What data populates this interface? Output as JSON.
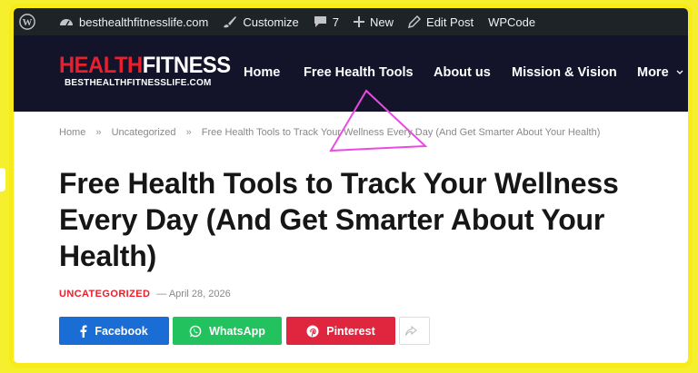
{
  "adminbar": {
    "site": "besthealthfitnesslife.com",
    "customize": "Customize",
    "comments_count": "7",
    "new_label": "New",
    "edit_post": "Edit Post",
    "wpcode": "WPCode"
  },
  "header": {
    "logo_red": "HEALTH",
    "logo_white": "FITNESS",
    "logo_sub": "BESTHEALTHFITNESSLIFE.COM",
    "nav": [
      "Home",
      "Free Health Tools",
      "About us",
      "Mission & Vision",
      "More"
    ]
  },
  "breadcrumb": {
    "home": "Home",
    "sep1": "»",
    "category": "Uncategorized",
    "sep2": "»",
    "current": "Free Health Tools to Track Your Wellness Every Day (And Get Smarter About Your Health)"
  },
  "post": {
    "title": "Free Health Tools to Track Your Wellness Every Day (And Get Smarter About Your Health)",
    "category": "UNCATEGORIZED",
    "date": "— April 28, 2026"
  },
  "share": {
    "facebook": "Facebook",
    "whatsapp": "WhatsApp",
    "pinterest": "Pinterest"
  },
  "colors": {
    "frame": "#f7ec1a",
    "adminbar": "#1d2327",
    "header": "#131329",
    "accent_red": "#e8202c",
    "facebook": "#1a6dd4",
    "whatsapp": "#22c35e",
    "pinterest": "#e0263f",
    "annotation": "#e94be0"
  }
}
